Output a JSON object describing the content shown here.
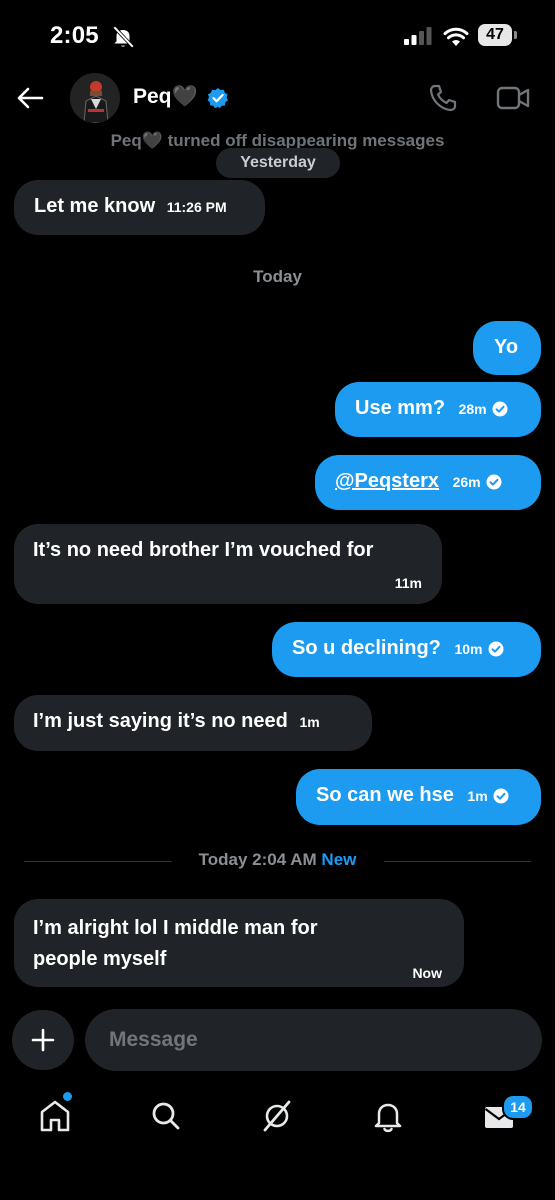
{
  "status_bar": {
    "time": "2:05",
    "battery": "47"
  },
  "header": {
    "name": "Peq🖤"
  },
  "system_message": "Peq🖤 turned off disappearing messages",
  "day_labels": {
    "yesterday": "Yesterday",
    "today": "Today"
  },
  "messages": [
    {
      "direction": "in",
      "text": "Let me know",
      "time": "11:26 PM"
    },
    {
      "direction": "out",
      "text": "Yo",
      "time": ""
    },
    {
      "direction": "out",
      "text": "Use mm?",
      "time": "28m"
    },
    {
      "direction": "out",
      "text": "@Peqsterx",
      "time": "26m"
    },
    {
      "direction": "in",
      "text": "It’s no need brother I’m vouched for",
      "time": "11m"
    },
    {
      "direction": "out",
      "text": "So u declining?",
      "time": "10m"
    },
    {
      "direction": "in",
      "text": "I’m just saying it’s no need",
      "time": "1m"
    },
    {
      "direction": "out",
      "text": "So can we hse",
      "time": "1m"
    },
    {
      "direction": "in",
      "text": "I’m alright lol I middle man for people myself",
      "time": "Now"
    }
  ],
  "new_divider": {
    "text": "Today 2:04 AM",
    "tag": "New"
  },
  "composer": {
    "placeholder": "Message"
  },
  "tab_bar": {
    "messages_badge": "14"
  },
  "colors": {
    "accent": "#1d9bf0",
    "bubble_in": "#202327",
    "background": "#000000"
  }
}
